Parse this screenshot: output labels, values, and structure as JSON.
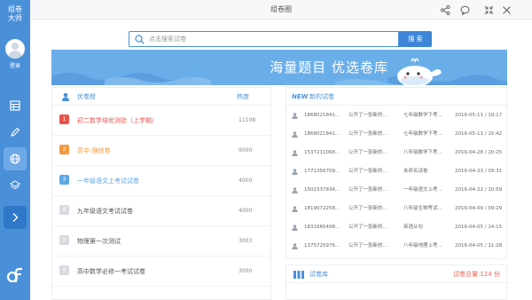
{
  "app": {
    "brand_line1": "组卷",
    "brand_line2": "大师",
    "login_label": "登录",
    "window_title": "组卷圈"
  },
  "search": {
    "placeholder": "点击搜索试卷",
    "button_label": "搜 索"
  },
  "banner": {
    "slogan": "海量题目   优选卷库"
  },
  "ranking": {
    "title": "优卷榜",
    "hot_header": "热度",
    "items": [
      {
        "rank": "1",
        "name": "初二数学培优测验（上学期）",
        "hot": "11108",
        "color": "#e8534a",
        "text_color": "#e8534a"
      },
      {
        "rank": "2",
        "name": "高中-理综卷",
        "hot": "9000",
        "color": "#f39a3c",
        "text_color": "#f39a3c"
      },
      {
        "rank": "3",
        "name": "一年级语文上考试试卷",
        "hot": "4000",
        "color": "#5aa7e8",
        "text_color": "#5aa7e8"
      },
      {
        "rank": "4",
        "name": "九年级语文考试试卷",
        "hot": "4000",
        "color": "#d8dbe0",
        "text_color": "#555555"
      },
      {
        "rank": "5",
        "name": "物理第一次测试",
        "hot": "3003",
        "color": "#d8dbe0",
        "text_color": "#555555"
      },
      {
        "rank": "6",
        "name": "高中数学必修一考试试卷",
        "hot": "3000",
        "color": "#d8dbe0",
        "text_color": "#555555"
      }
    ]
  },
  "new_papers": {
    "tag": "NEW",
    "title": "新的试卷",
    "rows": [
      {
        "user": "1868021841…",
        "desc": "公开了一张新的…",
        "paper": "七年级数学下考…",
        "time": "2016-05-11 / 19:17"
      },
      {
        "user": "1868021841…",
        "desc": "公开了一张新的…",
        "paper": "七年级数学下考…",
        "time": "2016-05-11 / 15:42"
      },
      {
        "user": "1537211068…",
        "desc": "公开了一张新的…",
        "paper": "八年级数学下考…",
        "time": "2016-04-28 / 20:25"
      },
      {
        "user": "1771356709…",
        "desc": "公开了一张新的…",
        "paper": "未命名试卷",
        "time": "2016-04-23 / 09:31"
      },
      {
        "user": "1502337834…",
        "desc": "公开了一张新的…",
        "paper": "一年级语文上考…",
        "time": "2016-04-22 / 10:59"
      },
      {
        "user": "1819072258…",
        "desc": "公开了一张新的…",
        "paper": "八年级生物考试…",
        "time": "2016-04-09 / 09:29"
      },
      {
        "user": "1831665498…",
        "desc": "公开了一张新的…",
        "paper": "英语从句",
        "time": "2016-04-05 / 14:15"
      },
      {
        "user": "1375725976…",
        "desc": "公开了一张新的…",
        "paper": "八年级地理上考…",
        "time": "2016-04-05 / 11:28"
      }
    ]
  },
  "library": {
    "title": "试卷库",
    "total": "试卷总量:124 份"
  },
  "colors": {
    "primary": "#4a90d9",
    "banner": "#6aaee9",
    "accent_red": "#e8534a"
  }
}
